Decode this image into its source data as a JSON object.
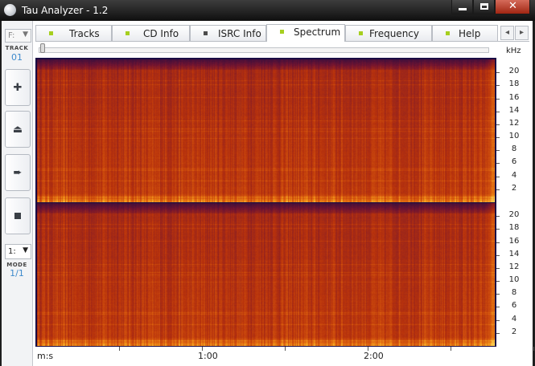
{
  "window": {
    "title": "Tau Analyzer - 1.2"
  },
  "sidebar": {
    "drive": {
      "value": "F:"
    },
    "track_label": "TRACK",
    "track_number": "01",
    "mode_select": {
      "value": "1:"
    },
    "mode_label": "MODE",
    "mode_value": "1/1"
  },
  "tabs": [
    {
      "label": "Tracks",
      "indicator": "green"
    },
    {
      "label": "CD Info",
      "indicator": "green"
    },
    {
      "label": "ISRC Info",
      "indicator": "grey"
    },
    {
      "label": "Spectrum",
      "indicator": "green",
      "active": true
    },
    {
      "label": "Frequency",
      "indicator": "green"
    },
    {
      "label": "Help",
      "indicator": "green"
    }
  ],
  "spectrum": {
    "freq_unit": "kHz",
    "freq_ticks": [
      "20",
      "18",
      "16",
      "14",
      "12",
      "10",
      "8",
      "6",
      "4",
      "2"
    ],
    "time_unit": "m:s",
    "time_labels": [
      "1:00",
      "2:00"
    ],
    "colors": {
      "low": "#1a0c44",
      "mid": "#b8320c",
      "high": "#ffe066"
    }
  }
}
